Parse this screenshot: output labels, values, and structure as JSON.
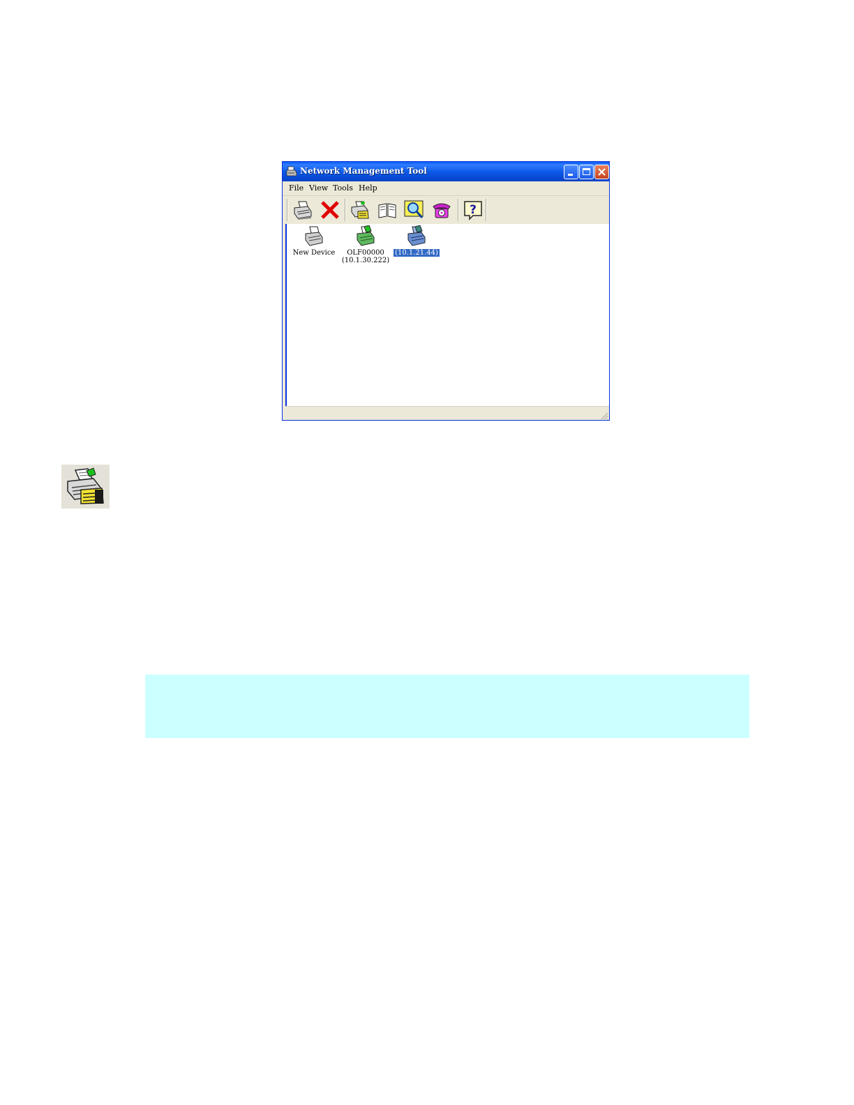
{
  "window": {
    "title": "Network Management Tool",
    "icon": "printer-app-icon",
    "controls": [
      "minimize",
      "maximize",
      "close"
    ]
  },
  "menu": {
    "items": [
      "File",
      "View",
      "Tools",
      "Help"
    ]
  },
  "toolbar": {
    "buttons": [
      {
        "icon": "printer-icon"
      },
      {
        "icon": "delete-x-icon"
      },
      {
        "icon": "printer-hand-icon"
      },
      {
        "icon": "book-icon"
      },
      {
        "icon": "magnifier-icon"
      },
      {
        "icon": "telephone-icon"
      },
      {
        "icon": "help-icon"
      }
    ]
  },
  "devices": [
    {
      "label_line1": "New Device",
      "label_line2": "",
      "status": "gray",
      "selected": false
    },
    {
      "label_line1": "OLF00000",
      "label_line2": "(10.1.30.222)",
      "status": "green",
      "selected": false
    },
    {
      "label_line1": "",
      "label_line2": "(10.1.21.44)",
      "status": "blue",
      "selected": true
    }
  ],
  "standalone_icon": {
    "icon": "printer-hand-icon"
  },
  "colors": {
    "title_bar": "#0a5cf5",
    "selection": "#316ac5",
    "note_background": "#ccffff",
    "window_face": "#ece9d8"
  }
}
